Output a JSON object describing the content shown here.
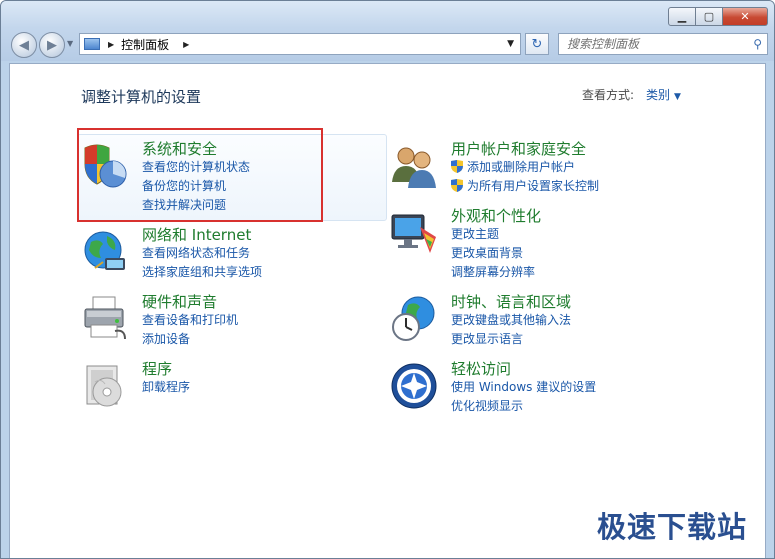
{
  "window": {
    "minimize_icon": "minimize-icon",
    "maximize_icon": "maximize-icon",
    "close_icon": "close-icon"
  },
  "nav": {
    "back_icon": "back-arrow-icon",
    "forward_icon": "forward-arrow-icon",
    "address_crumb": "控制面板",
    "refresh_icon": "refresh-icon",
    "search_placeholder": "搜索控制面板"
  },
  "main": {
    "heading": "调整计算机的设置",
    "view_by_label": "查看方式:",
    "view_by_value": "类别"
  },
  "categories": [
    {
      "title": "系统和安全",
      "icon": "shield-pie-icon",
      "links": [
        "查看您的计算机状态",
        "备份您的计算机",
        "查找并解决问题"
      ]
    },
    {
      "title": "网络和 Internet",
      "icon": "globe-network-icon",
      "links": [
        "查看网络状态和任务",
        "选择家庭组和共享选项"
      ]
    },
    {
      "title": "硬件和声音",
      "icon": "printer-icon",
      "links": [
        "查看设备和打印机",
        "添加设备"
      ]
    },
    {
      "title": "程序",
      "icon": "programs-icon",
      "links": [
        "卸载程序"
      ]
    },
    {
      "title": "用户帐户和家庭安全",
      "icon": "users-icon",
      "links": [
        "添加或删除用户帐户",
        "为所有用户设置家长控制"
      ]
    },
    {
      "title": "外观和个性化",
      "icon": "monitor-paint-icon",
      "links": [
        "更改主题",
        "更改桌面背景",
        "调整屏幕分辨率"
      ]
    },
    {
      "title": "时钟、语言和区域",
      "icon": "clock-globe-icon",
      "links": [
        "更改键盘或其他输入法",
        "更改显示语言"
      ]
    },
    {
      "title": "轻松访问",
      "icon": "ease-of-access-icon",
      "links": [
        "使用 Windows 建议的设置",
        "优化视频显示"
      ]
    }
  ],
  "watermark": "极速下载站",
  "colors": {
    "category_title": "#1f7c2e",
    "link": "#1a57a8",
    "highlight_box": "#d8312f"
  }
}
